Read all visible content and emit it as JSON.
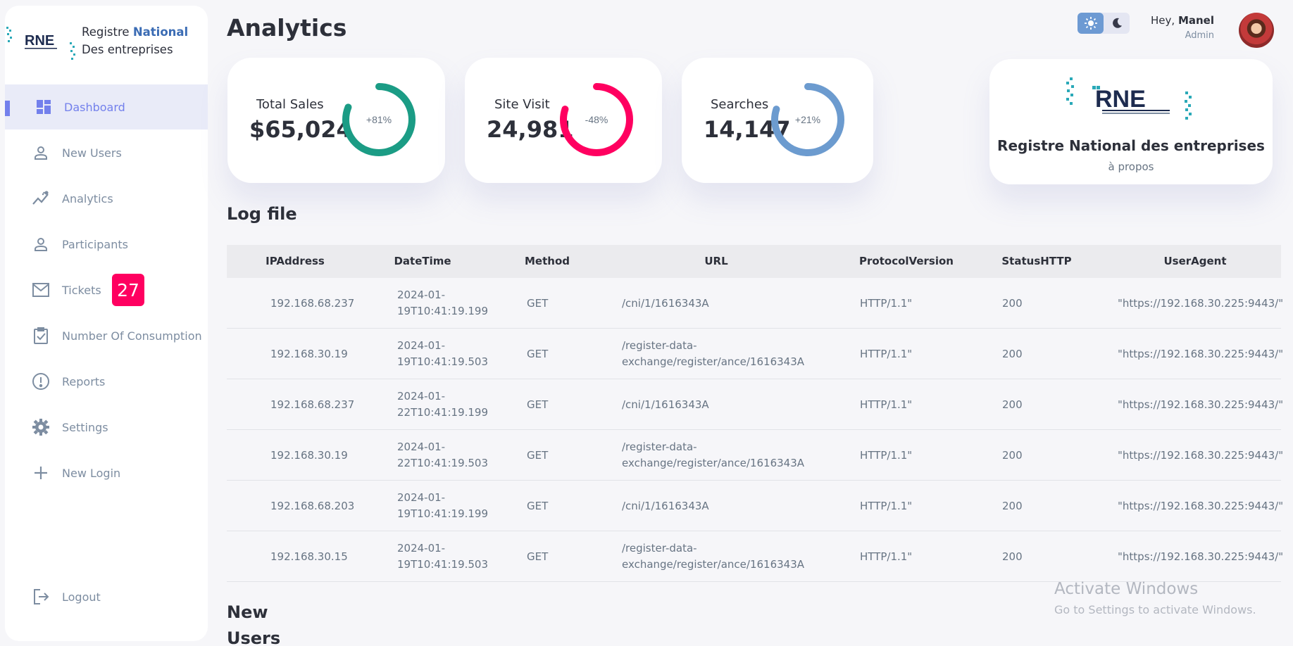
{
  "brand": {
    "line1_prefix": "Registre ",
    "line1_accent": "National",
    "line2": "Des entreprises"
  },
  "sidebar": {
    "items": [
      {
        "label": "Dashboard",
        "icon": "dashboard-icon",
        "active": true
      },
      {
        "label": "New Users",
        "icon": "person-icon"
      },
      {
        "label": "Analytics",
        "icon": "insights-icon"
      },
      {
        "label": "Participants",
        "icon": "person-icon"
      },
      {
        "label": "Tickets",
        "icon": "mail-icon",
        "badge": "27"
      },
      {
        "label": "Number Of Consumption",
        "icon": "clipboard-check-icon"
      },
      {
        "label": "Reports",
        "icon": "report-icon"
      },
      {
        "label": "Settings",
        "icon": "gear-icon"
      },
      {
        "label": "New Login",
        "icon": "plus-icon"
      }
    ],
    "logout": "Logout"
  },
  "header": {
    "title": "Analytics",
    "greeting_prefix": "Hey, ",
    "user_name": "Manel",
    "role": "Admin"
  },
  "stats": [
    {
      "label": "Total Sales",
      "value": "$65,024",
      "percent": "+81%",
      "fraction": 0.81,
      "color": "#1b9c85"
    },
    {
      "label": "Site Visit",
      "value": "24,981",
      "percent": "-48%",
      "fraction": 0.8,
      "color": "#ff0060"
    },
    {
      "label": "Searches",
      "value": "14,147",
      "percent": "+21%",
      "fraction": 0.8,
      "color": "#6c9bcf"
    }
  ],
  "about": {
    "title": "Registre National des entreprises",
    "link": "à propos"
  },
  "log_section": {
    "title": "Log file",
    "columns": [
      "IPAddress",
      "DateTime",
      "Method",
      "URL",
      "ProtocolVersion",
      "StatusHTTP",
      "UserAgent"
    ],
    "rows": [
      [
        "192.168.68.237",
        "2024-01-\n19T10:41:19.199",
        "GET",
        "/cni/1/1616343A",
        "HTTP/1.1\"",
        "200",
        "\"https://192.168.30.225:9443/\""
      ],
      [
        "192.168.30.19",
        "2024-01-\n19T10:41:19.503",
        "GET",
        "/register-data-\nexchange/register/ance/1616343A",
        "HTTP/1.1\"",
        "200",
        "\"https://192.168.30.225:9443/\""
      ],
      [
        "192.168.68.237",
        "2024-01-\n22T10:41:19.199",
        "GET",
        "/cni/1/1616343A",
        "HTTP/1.1\"",
        "200",
        "\"https://192.168.30.225:9443/\""
      ],
      [
        "192.168.30.19",
        "2024-01-\n22T10:41:19.503",
        "GET",
        "/register-data-\nexchange/register/ance/1616343A",
        "HTTP/1.1\"",
        "200",
        "\"https://192.168.30.225:9443/\""
      ],
      [
        "192.168.68.203",
        "2024-01-\n19T10:41:19.199",
        "GET",
        "/cni/1/1616343A",
        "HTTP/1.1\"",
        "200",
        "\"https://192.168.30.225:9443/\""
      ],
      [
        "192.168.30.15",
        "2024-01-\n19T10:41:19.503",
        "GET",
        "/register-data-\nexchange/register/ance/1616343A",
        "HTTP/1.1\"",
        "200",
        "\"https://192.168.30.225:9443/\""
      ]
    ]
  },
  "new_users_section": {
    "title_line1": "New",
    "title_line2": "Users"
  },
  "watermark": {
    "line1": "Activate Windows",
    "line2": "Go to Settings to activate Windows."
  }
}
